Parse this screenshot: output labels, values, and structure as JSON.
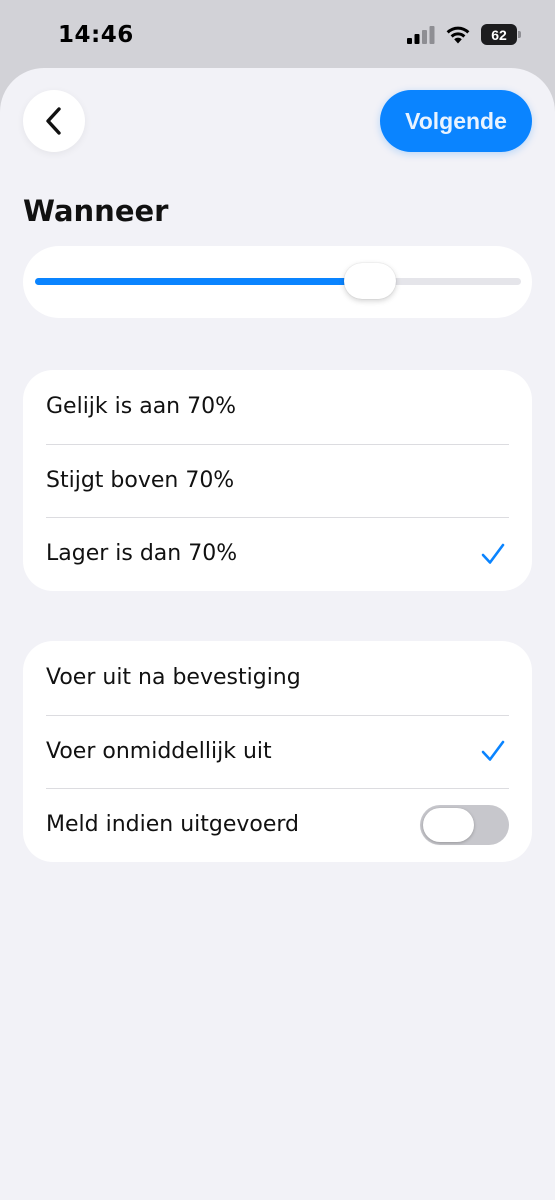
{
  "status_bar": {
    "time": "14:46",
    "battery_level": "62",
    "signal_icon": "cellular-signal-icon",
    "wifi_icon": "wifi-icon"
  },
  "header": {
    "back_icon": "chevron-left-icon",
    "next_label": "Volgende"
  },
  "section": {
    "title": "Wanneer"
  },
  "slider": {
    "value_percent": 70,
    "accent_color": "#0a84ff"
  },
  "conditions": {
    "items": [
      {
        "label": "Gelijk is aan 70%",
        "selected": false
      },
      {
        "label": "Stijgt boven 70%",
        "selected": false
      },
      {
        "label": "Lager is dan 70%",
        "selected": true
      }
    ]
  },
  "execution": {
    "items": [
      {
        "label": "Voer uit na bevestiging",
        "selected": false
      },
      {
        "label": "Voer onmiddellijk uit",
        "selected": true
      }
    ],
    "notify": {
      "label": "Meld indien uitgevoerd",
      "enabled": false
    }
  }
}
